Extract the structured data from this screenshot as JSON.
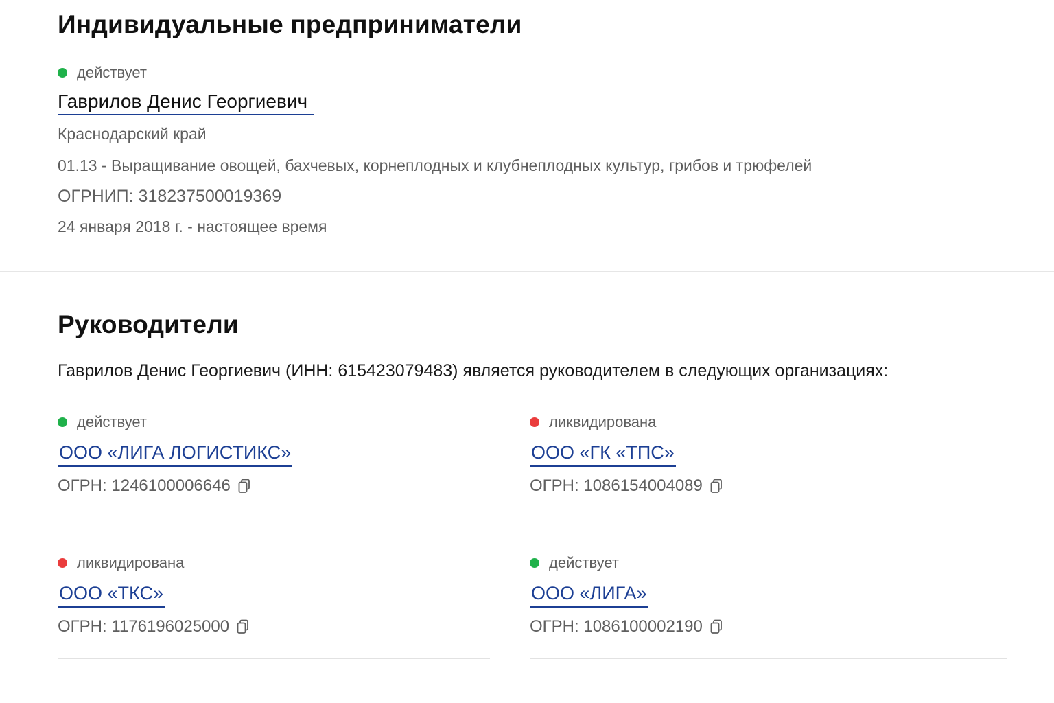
{
  "entrepreneurs": {
    "title": "Индивидуальные предприниматели",
    "status": {
      "label": "действует",
      "color": "#1fb14a"
    },
    "name": "Гаврилов Денис Георгиевич",
    "region": "Краснодарский край",
    "activity": "01.13 - Выращивание овощей, бахчевых, корнеплодных и клубнеплодных культур, грибов и трюфелей",
    "ogrnip": "ОГРНИП: 318237500019369",
    "period": "24 января 2018 г. - настоящее время"
  },
  "managers": {
    "title": "Руководители",
    "lead": "Гаврилов Денис Георгиевич (ИНН: 615423079483) является руководителем в следующих организациях:",
    "organizations": [
      {
        "status": "действует",
        "status_color": "#1fb14a",
        "name": "ООО «ЛИГА ЛОГИСТИКС»",
        "ogrn": "ОГРН: 1246100006646"
      },
      {
        "status": "ликвидирована",
        "status_color": "#ea3c3c",
        "name": "ООО «ГК «ТПС»",
        "ogrn": "ОГРН: 1086154004089"
      },
      {
        "status": "ликвидирована",
        "status_color": "#ea3c3c",
        "name": "ООО «ТКС»",
        "ogrn": "ОГРН: 1176196025000"
      },
      {
        "status": "действует",
        "status_color": "#1fb14a",
        "name": "ООО «ЛИГА»",
        "ogrn": "ОГРН: 1086100002190"
      }
    ]
  },
  "colors": {
    "link": "#1c3f94",
    "active": "#1fb14a",
    "liquidated": "#ea3c3c"
  },
  "icons": {
    "copy": "copy-icon"
  }
}
